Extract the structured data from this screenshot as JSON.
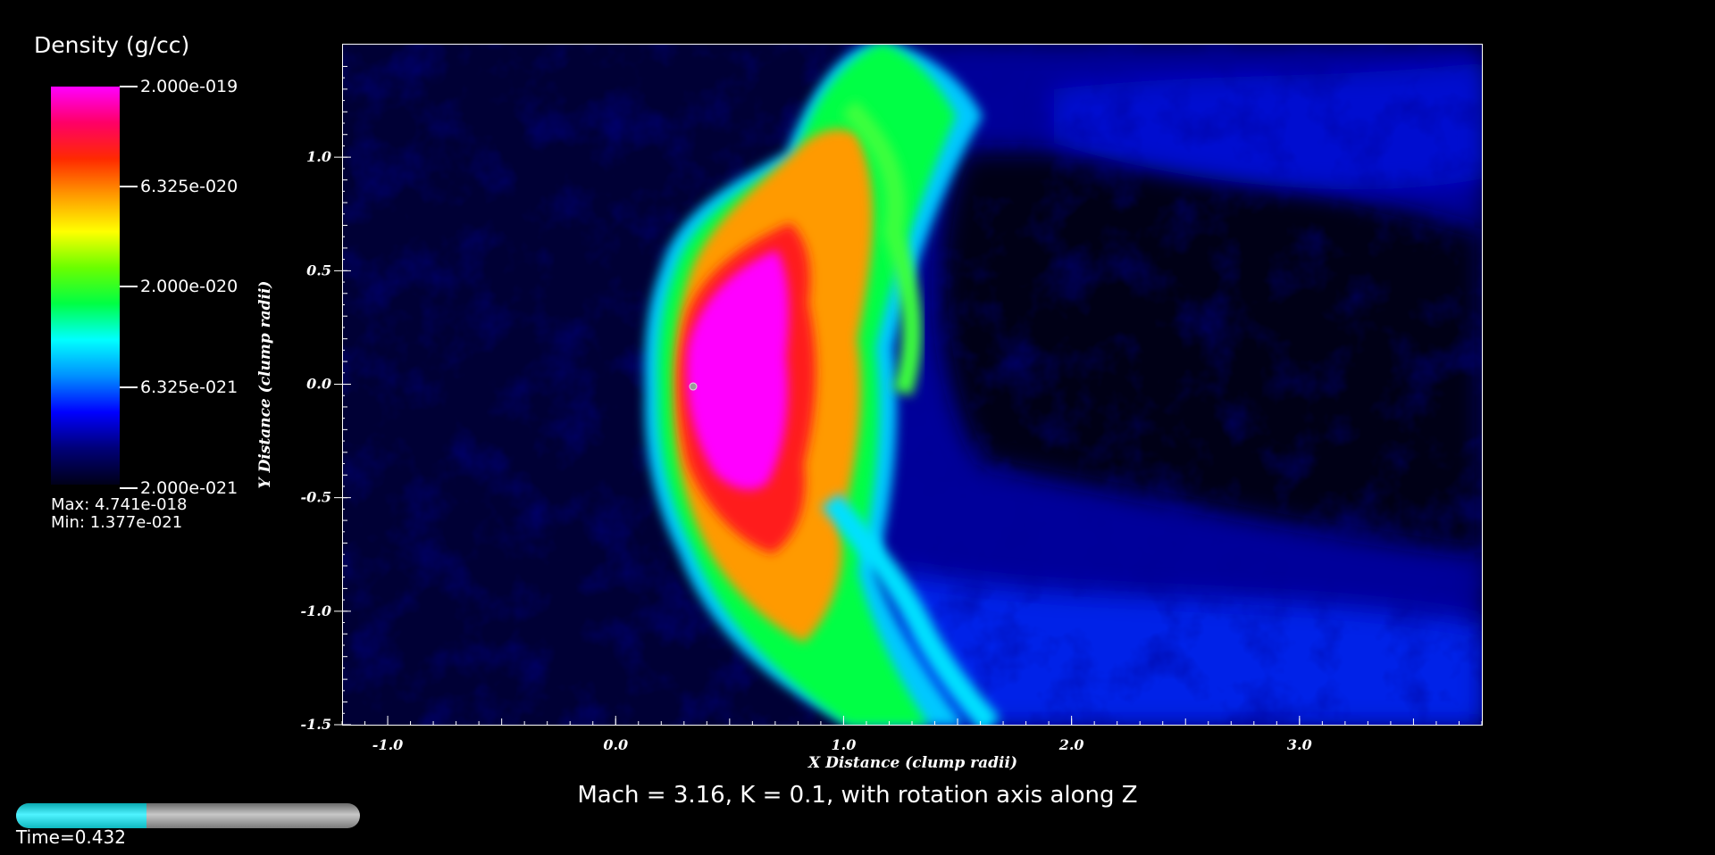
{
  "legend": {
    "title": "Density (g/cc)",
    "labels": [
      "2.000e-019",
      "6.325e-020",
      "2.000e-020",
      "6.325e-021",
      "2.000e-021"
    ],
    "max_text": "Max:  4.741e-018",
    "min_text": "Min:  1.377e-021",
    "colors": [
      "#ff00ff",
      "#ff0066",
      "#ff2a00",
      "#ff9a00",
      "#ffff00",
      "#6aff00",
      "#00ff44",
      "#00ffff",
      "#0090ff",
      "#0000ff",
      "#000078",
      "#000018"
    ]
  },
  "chart_data": {
    "type": "heatmap",
    "title": "Mach = 3.16, K = 0.1, with rotation axis along Z",
    "xlabel": "X Distance (clump radii)",
    "ylabel": "Y Distance (clump radii)",
    "xlim": [
      -1.2,
      3.8
    ],
    "ylim": [
      -1.5,
      1.5
    ],
    "xticks": [
      -1.0,
      0.0,
      1.0,
      2.0,
      3.0
    ],
    "xtick_labels": [
      "-1.0",
      "0.0",
      "1.0",
      "2.0",
      "3.0"
    ],
    "yticks": [
      -1.5,
      -1.0,
      -0.5,
      0.0,
      0.5,
      1.0
    ],
    "ytick_labels": [
      "-1.5",
      "-1.0",
      "-0.5",
      "0.0",
      "0.5",
      "1.0"
    ],
    "colormap": "hot_desaturated_magenta_to_black",
    "color_scale": "log",
    "clim": [
      2e-21,
      2e-19
    ],
    "marker": {
      "x": 0.34,
      "y": -0.01
    }
  },
  "time": {
    "label": "Time=0.432",
    "progress": 0.38
  }
}
